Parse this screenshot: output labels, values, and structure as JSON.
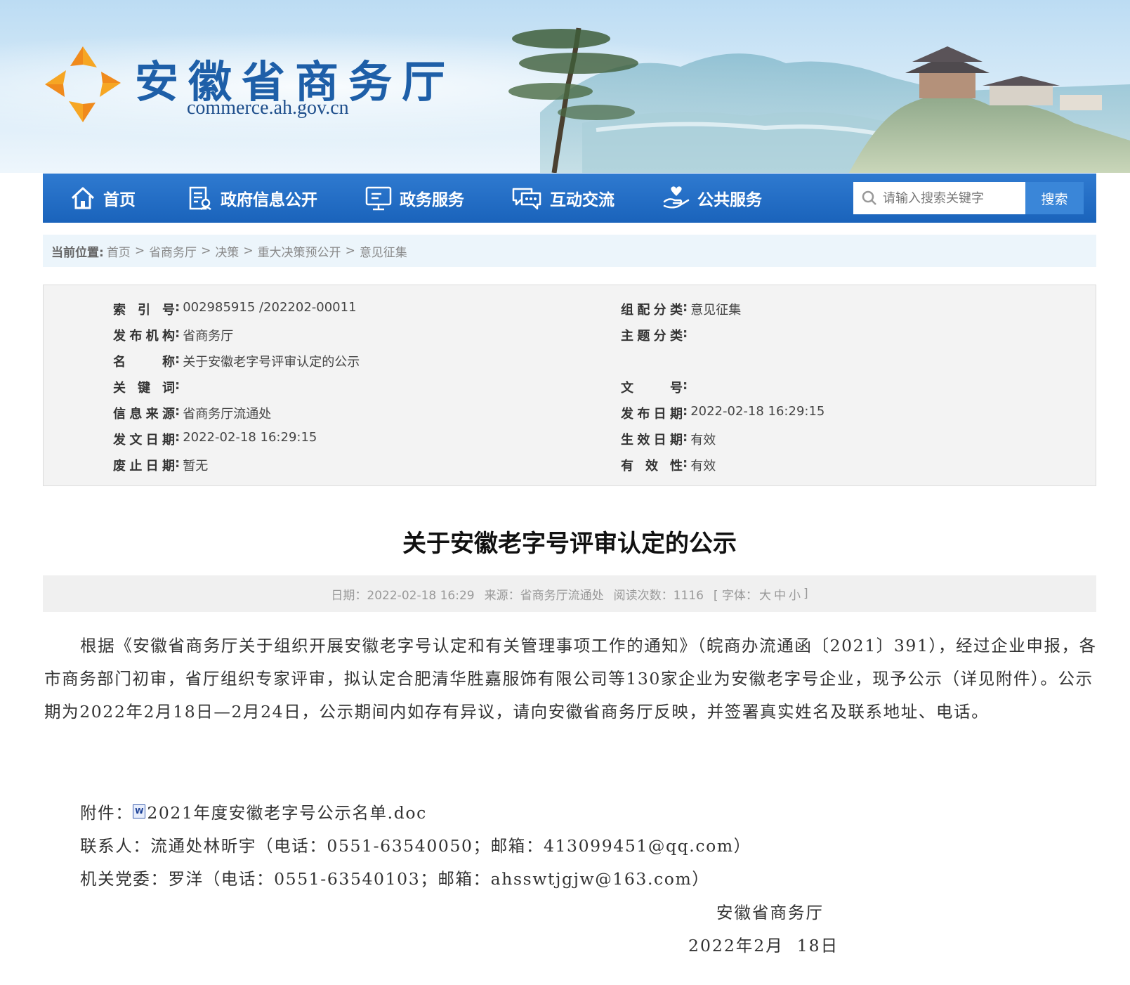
{
  "header": {
    "site_name": "安徽省商务厅",
    "site_url": "commerce.ah.gov.cn"
  },
  "nav": {
    "items": [
      {
        "label": "首页",
        "icon": "home-icon"
      },
      {
        "label": "政府信息公开",
        "icon": "document-icon"
      },
      {
        "label": "政务服务",
        "icon": "monitor-icon"
      },
      {
        "label": "互动交流",
        "icon": "chat-icon"
      },
      {
        "label": "公共服务",
        "icon": "hand-heart-icon"
      }
    ],
    "search_placeholder": "请输入搜索关键字",
    "search_button": "搜索"
  },
  "breadcrumb": {
    "lead": "当前位置:",
    "items": [
      "首页",
      "省商务厅",
      "决策",
      "重大决策预公开",
      "意见征集"
    ],
    "separator": ">"
  },
  "info": {
    "left": [
      {
        "key": "索 引 号",
        "value": "002985915 /202202-00011"
      },
      {
        "key": "发布机构",
        "value": "省商务厅"
      },
      {
        "key": "名 称",
        "value": "关于安徽老字号评审认定的公示"
      },
      {
        "key": "关 键 词",
        "value": ""
      },
      {
        "key": "信息来源",
        "value": "省商务厅流通处"
      },
      {
        "key": "发文日期",
        "value": "2022-02-18 16:29:15"
      },
      {
        "key": "废止日期",
        "value": "暂无"
      }
    ],
    "right": [
      {
        "key": "组配分类",
        "value": "意见征集"
      },
      {
        "key": "主题分类",
        "value": ""
      },
      {
        "key": "文 号",
        "value": ""
      },
      {
        "key": "发布日期",
        "value": "2022-02-18 16:29:15"
      },
      {
        "key": "生效日期",
        "value": "有效"
      },
      {
        "key": "有 效 性",
        "value": "有效"
      }
    ]
  },
  "article": {
    "title": "关于安徽老字号评审认定的公示",
    "meta": {
      "date": "日期：2022-02-18 16:29",
      "source": "来源：省商务厅流通处",
      "views": "阅读次数：1116",
      "font_prefix": "[ 字体：",
      "font_large": "大",
      "font_medium": "中",
      "font_small": "小",
      "font_suffix": "]"
    },
    "body": "根据《安徽省商务厅关于组织开展安徽老字号认定和有关管理事项工作的通知》（皖商办流通函〔2021〕391），经过企业申报，各市商务部门初审，省厅组织专家评审，拟认定合肥清华胜嘉服饰有限公司等130家企业为安徽老字号企业，现予公示（详见附件）。公示期为2022年2月18日—2月24日，公示期间内如存有异议，请向安徽省商务厅反映，并签署真实姓名及联系地址、电话。",
    "attachment_label": "附件：",
    "attachment_file": "2021年度安徽老字号公示名单.doc",
    "contact": "联系人：流通处林昕宇（电话：0551-63540050；邮箱：413099451@qq.com）",
    "party": "机关党委：罗洋（电话：0551-63540103；邮箱：ahsswtjgjw@163.com）",
    "signature": "安徽省商务厅",
    "sign_date": "2022年2月  18日"
  },
  "colors": {
    "nav_bg": "#1a63bb",
    "title_blue": "#1e5fa8",
    "search_btn": "#3a86d8"
  }
}
